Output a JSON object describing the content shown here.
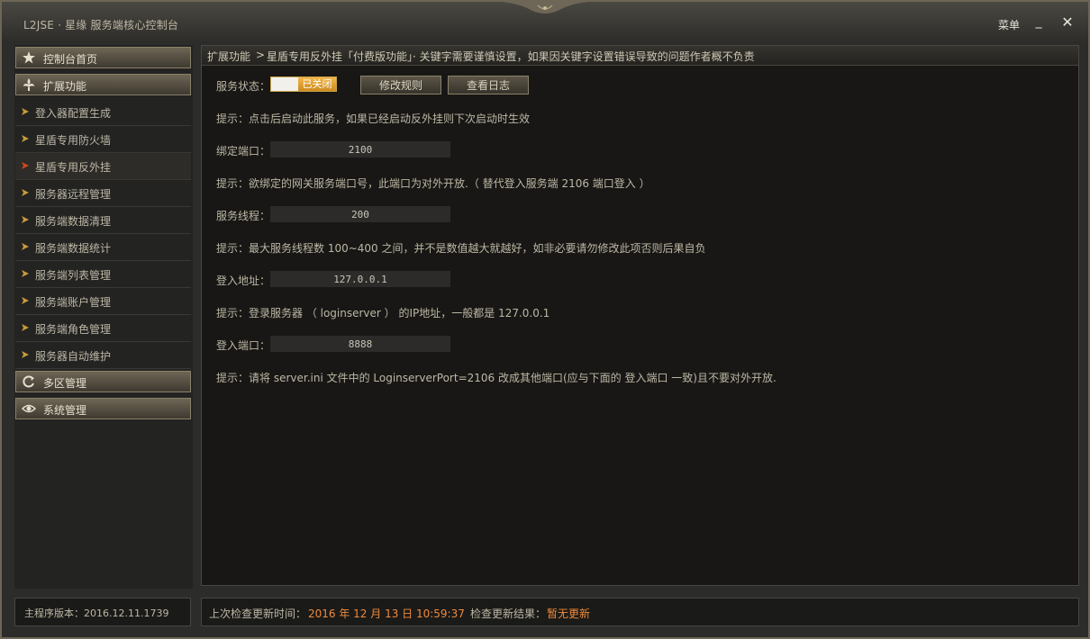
{
  "window": {
    "title": "L2JSE · 星缘 服务端核心控制台",
    "menu_label": "菜单",
    "minimize_glyph": "_",
    "close_glyph": "✕"
  },
  "sidebar": {
    "categories": [
      {
        "label": "控制台首页",
        "icon": "star-icon"
      },
      {
        "label": "扩展功能",
        "icon": "fleur-icon"
      },
      {
        "label": "多区管理",
        "icon": "refresh-icon"
      },
      {
        "label": "系统管理",
        "icon": "eye-icon"
      }
    ],
    "items": [
      {
        "label": "登入器配置生成"
      },
      {
        "label": "星盾专用防火墙"
      },
      {
        "label": "星盾专用反外挂",
        "active": true
      },
      {
        "label": "服务器远程管理"
      },
      {
        "label": "服务端数据清理"
      },
      {
        "label": "服务端数据统计"
      },
      {
        "label": "服务端列表管理"
      },
      {
        "label": "服务端账户管理"
      },
      {
        "label": "服务端角色管理"
      },
      {
        "label": "服务器自动维护"
      }
    ]
  },
  "version": {
    "label": "主程序版本：2016.12.11.1739"
  },
  "breadcrumb": {
    "section": "扩展功能",
    "separator": ">",
    "detail": "星盾专用反外挂「付费版功能」· 关键字需要谨慎设置，如果因关键字设置错误导致的问题作者概不负责"
  },
  "content": {
    "status_label": "服务状态：",
    "status_value": "已关闭",
    "edit_rules_button": "修改规则",
    "view_log_button": "查看日志",
    "tip1": "提示：点击后启动此服务，如果已经启动反外挂则下次启动时生效",
    "port_label": "绑定端口：",
    "port_value": "2100",
    "tip2": "提示：欲绑定的网关服务端口号，此端口为对外开放.（ 替代登入服务端 2106 端口登入 ）",
    "threads_label": "服务线程：",
    "threads_value": "200",
    "tip3": "提示：最大服务线程数 100~400 之间，并不是数值越大就越好，如非必要请勿修改此项否则后果自负",
    "login_addr_label": "登入地址：",
    "login_addr_value": "127.0.0.1",
    "tip4": "提示：登录服务器 （ loginserver ） 的IP地址，一般都是 127.0.0.1",
    "login_port_label": "登入端口：",
    "login_port_value": "8888",
    "tip5": "提示：请将 server.ini 文件中的 LoginserverPort=2106 改成其他端口(应与下面的 登入端口 一致)且不要对外开放."
  },
  "footer": {
    "last_check_label": "上次检查更新时间：",
    "last_check_value": "2016 年 12 月 13 日 10:59:37",
    "result_label": "检查更新结果：",
    "result_value": "暂无更新"
  },
  "colors": {
    "accent_orange": "#f08a3a",
    "status_orange": "#e0a030",
    "text": "#bdb7a5"
  }
}
